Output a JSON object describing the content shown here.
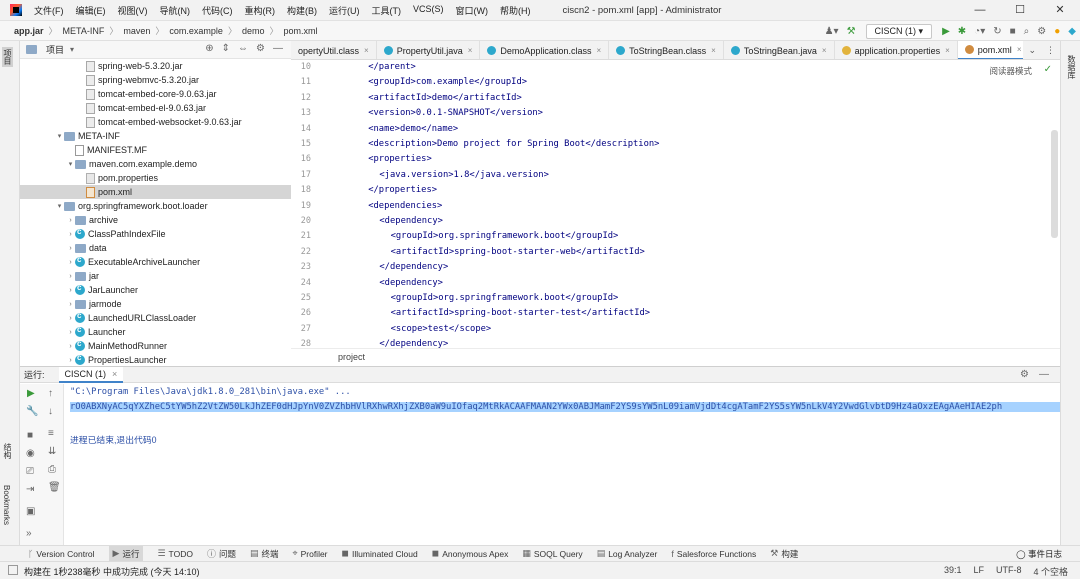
{
  "window": {
    "menu": [
      "文件(F)",
      "编辑(E)",
      "视图(V)",
      "导航(N)",
      "代码(C)",
      "重构(R)",
      "构建(B)",
      "运行(U)",
      "工具(T)",
      "VCS(S)",
      "窗口(W)",
      "帮助(H)"
    ],
    "title": "ciscn2 - pom.xml [app] - Administrator",
    "min": "—",
    "max": "☐",
    "close": "✕"
  },
  "nav": {
    "crumbs": [
      "app.jar",
      "META-INF",
      "maven",
      "com.example",
      "demo",
      "pom.xml"
    ],
    "run_config": "CISCN (1) ▾"
  },
  "side": {
    "left_project": "项目",
    "left_structure": "结构",
    "left_bookmarks": "Bookmarks",
    "right_db": "数据库"
  },
  "project": {
    "title": "项目",
    "tree": [
      {
        "label": "spring-web-5.3.20.jar",
        "depth": 5,
        "icon": "jar",
        "arrow": ""
      },
      {
        "label": "spring-webmvc-5.3.20.jar",
        "depth": 5,
        "icon": "jar",
        "arrow": ""
      },
      {
        "label": "tomcat-embed-core-9.0.63.jar",
        "depth": 5,
        "icon": "jar",
        "arrow": ""
      },
      {
        "label": "tomcat-embed-el-9.0.63.jar",
        "depth": 5,
        "icon": "jar",
        "arrow": ""
      },
      {
        "label": "tomcat-embed-websocket-9.0.63.jar",
        "depth": 5,
        "icon": "jar",
        "arrow": ""
      },
      {
        "label": "META-INF",
        "depth": 3,
        "icon": "folder",
        "arrow": "▾"
      },
      {
        "label": "MANIFEST.MF",
        "depth": 4,
        "icon": "mf",
        "arrow": ""
      },
      {
        "label": "maven.com.example.demo",
        "depth": 4,
        "icon": "folder",
        "arrow": "▾"
      },
      {
        "label": "pom.properties",
        "depth": 5,
        "icon": "file",
        "arrow": ""
      },
      {
        "label": "pom.xml",
        "depth": 5,
        "icon": "xml",
        "arrow": "",
        "selected": true
      },
      {
        "label": "org.springframework.boot.loader",
        "depth": 3,
        "icon": "folder",
        "arrow": "▾"
      },
      {
        "label": "archive",
        "depth": 4,
        "icon": "folder",
        "arrow": "›"
      },
      {
        "label": "ClassPathIndexFile",
        "depth": 4,
        "icon": "cls",
        "arrow": "›"
      },
      {
        "label": "data",
        "depth": 4,
        "icon": "folder",
        "arrow": "›"
      },
      {
        "label": "ExecutableArchiveLauncher",
        "depth": 4,
        "icon": "cls",
        "arrow": "›"
      },
      {
        "label": "jar",
        "depth": 4,
        "icon": "folder",
        "arrow": "›"
      },
      {
        "label": "JarLauncher",
        "depth": 4,
        "icon": "cls",
        "arrow": "›"
      },
      {
        "label": "jarmode",
        "depth": 4,
        "icon": "folder",
        "arrow": "›"
      },
      {
        "label": "LaunchedURLClassLoader",
        "depth": 4,
        "icon": "cls",
        "arrow": "›"
      },
      {
        "label": "Launcher",
        "depth": 4,
        "icon": "cls",
        "arrow": "›"
      },
      {
        "label": "MainMethodRunner",
        "depth": 4,
        "icon": "cls",
        "arrow": "›"
      },
      {
        "label": "PropertiesLauncher",
        "depth": 4,
        "icon": "cls",
        "arrow": "›"
      }
    ]
  },
  "tabs": [
    {
      "label": "opertyUtil.class",
      "color": "#2da8cc"
    },
    {
      "label": "PropertyUtil.java",
      "color": "#2da8cc"
    },
    {
      "label": "DemoApplication.class",
      "color": "#2da8cc"
    },
    {
      "label": "ToStringBean.class",
      "color": "#2da8cc"
    },
    {
      "label": "ToStringBean.java",
      "color": "#2da8cc"
    },
    {
      "label": "application.properties",
      "color": "#e2b33c"
    },
    {
      "label": "pom.xml",
      "color": "#d08c40",
      "active": true
    }
  ],
  "editor": {
    "reader_mode": "阅读器模式",
    "status_crumb": "project",
    "lines": [
      {
        "n": "10",
        "indent": 2,
        "text": "</parent>"
      },
      {
        "n": "11",
        "indent": 2,
        "text": "<groupId>com.example</groupId>"
      },
      {
        "n": "12",
        "indent": 2,
        "text": "<artifactId>demo</artifactId>"
      },
      {
        "n": "13",
        "indent": 2,
        "text": "<version>0.0.1-SNAPSHOT</version>"
      },
      {
        "n": "14",
        "indent": 2,
        "text": "<name>demo</name>"
      },
      {
        "n": "15",
        "indent": 2,
        "text": "<description>Demo project for Spring Boot</description>"
      },
      {
        "n": "16",
        "indent": 2,
        "text": "<properties>"
      },
      {
        "n": "17",
        "indent": 4,
        "text": "<java.version>1.8</java.version>"
      },
      {
        "n": "18",
        "indent": 2,
        "text": "</properties>"
      },
      {
        "n": "19",
        "indent": 2,
        "text": "<dependencies>"
      },
      {
        "n": "20",
        "indent": 4,
        "text": "<dependency>"
      },
      {
        "n": "21",
        "indent": 6,
        "text": "<groupId>org.springframework.boot</groupId>"
      },
      {
        "n": "22",
        "indent": 6,
        "text": "<artifactId>spring-boot-starter-web</artifactId>"
      },
      {
        "n": "23",
        "indent": 4,
        "text": "</dependency>"
      },
      {
        "n": "24",
        "indent": 4,
        "text": "<dependency>"
      },
      {
        "n": "25",
        "indent": 6,
        "text": "<groupId>org.springframework.boot</groupId>"
      },
      {
        "n": "26",
        "indent": 6,
        "text": "<artifactId>spring-boot-starter-test</artifactId>"
      },
      {
        "n": "27",
        "indent": 6,
        "text": "<scope>test</scope>"
      },
      {
        "n": "28",
        "indent": 4,
        "text": "</dependency>"
      }
    ]
  },
  "run": {
    "label": "运行:",
    "tab": "CISCN (1)",
    "cmd": "\"C:\\Program Files\\Java\\jdk1.8.0_281\\bin\\java.exe\" ...",
    "payload": "rO0ABXNyAC5qYXZheC5tYW5hZ2VtZW50LkJhZEF0dHJpYnV0ZVZhbHVlRXhwRXhjZXB0aW9uIOfaq2MtRkACAAFMAAN2YWx0ABJMamF2YS9sYW5nL09iamVjdDt4cgATamF2YS5sYW5nLkV4Y2VwdGlvbtD9Hz4aOxzEAgAAeHIAE2ph",
    "exit": "进程已结束,退出代码0"
  },
  "bottom": {
    "items": [
      {
        "icon": "ᚴ",
        "label": "Version Control"
      },
      {
        "icon": "▶",
        "label": "运行",
        "active": true
      },
      {
        "icon": "☰",
        "label": "TODO"
      },
      {
        "icon": "ⓘ",
        "label": "问题"
      },
      {
        "icon": "▤",
        "label": "终端"
      },
      {
        "icon": "⌖",
        "label": "Profiler"
      },
      {
        "icon": "◼",
        "label": "Illuminated Cloud"
      },
      {
        "icon": "◼",
        "label": "Anonymous Apex"
      },
      {
        "icon": "▦",
        "label": "SOQL Query"
      },
      {
        "icon": "▤",
        "label": "Log Analyzer"
      },
      {
        "icon": "f",
        "label": "Salesforce Functions"
      },
      {
        "icon": "⚒",
        "label": "构建"
      }
    ],
    "event_log": "事件日志"
  },
  "status": {
    "message": "构建在 1秒238毫秒 中成功完成 (今天 14:10)",
    "position": "39:1",
    "line_sep": "LF",
    "encoding": "UTF-8",
    "indent": "4 个空格"
  }
}
